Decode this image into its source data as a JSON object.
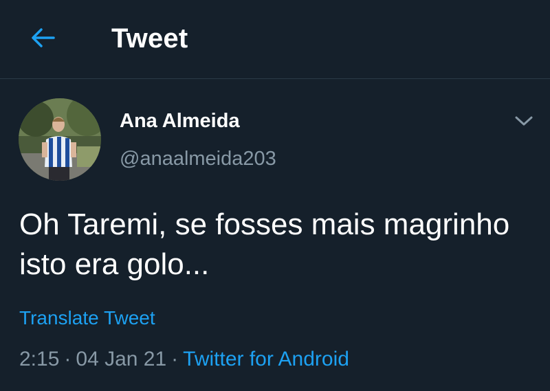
{
  "header": {
    "title": "Tweet",
    "back_icon": "arrow-left-icon"
  },
  "tweet": {
    "author_name": "Ana Almeida",
    "author_handle": "@anaalmeida203",
    "text": "Oh Taremi, se fosses mais magrinho isto era golo...",
    "translate_label": "Translate Tweet",
    "time": "2:15",
    "date": "04 Jan 21",
    "separator": "·",
    "source": "Twitter for Android",
    "menu_icon": "chevron-down-icon"
  },
  "colors": {
    "background": "#15202b",
    "accent": "#1da1f2",
    "muted": "#8899a6",
    "text": "#ffffff",
    "divider": "#2b3a47"
  }
}
